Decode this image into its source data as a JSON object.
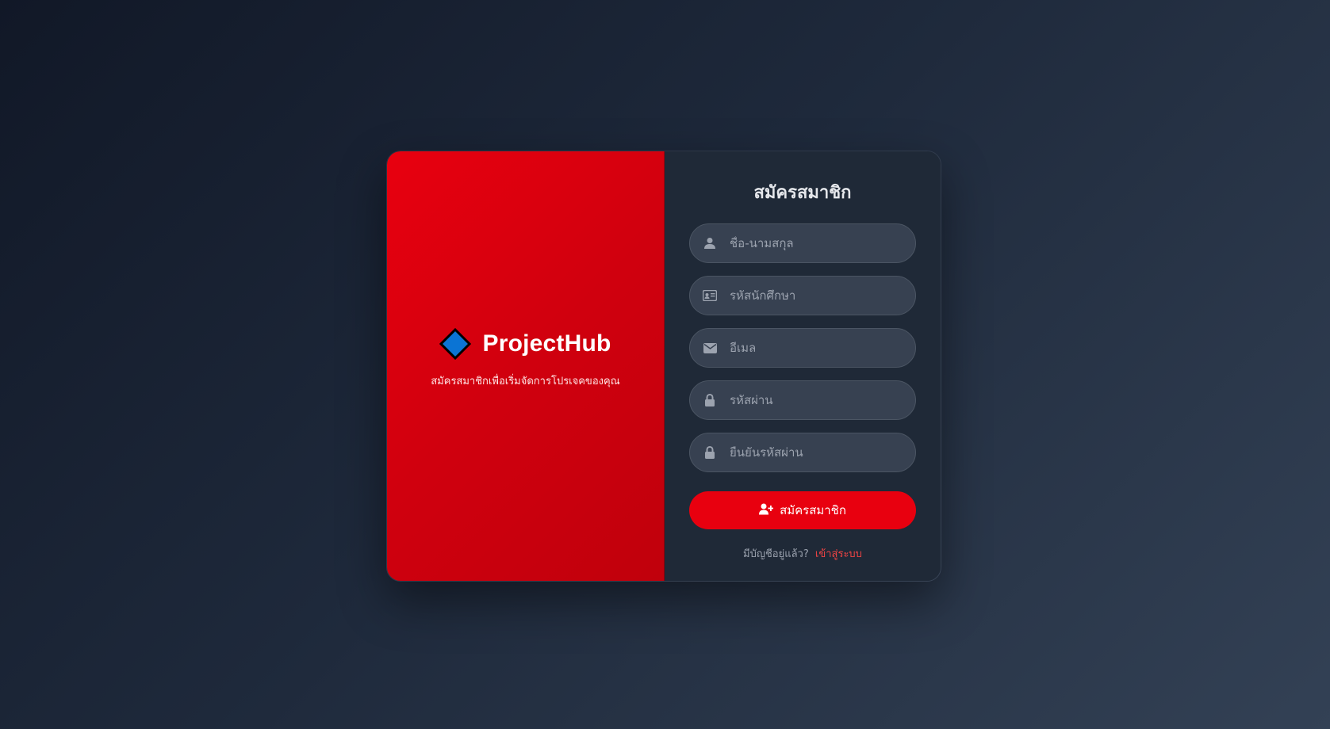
{
  "brand": {
    "title": "ProjectHub",
    "subtitle": "สมัครสมาชิกเพื่อเริ่มจัดการโปรเจคของคุณ",
    "icon": "diamond-icon"
  },
  "form": {
    "title": "สมัครสมาชิก",
    "fields": [
      {
        "placeholder": "ชื่อ-นามสกุล",
        "value": "",
        "icon": "user-icon"
      },
      {
        "placeholder": "รหัสนักศึกษา",
        "value": "",
        "icon": "id-card-icon"
      },
      {
        "placeholder": "อีเมล",
        "value": "",
        "icon": "envelope-icon"
      },
      {
        "placeholder": "รหัสผ่าน",
        "value": "",
        "icon": "lock-icon"
      },
      {
        "placeholder": "ยืนยันรหัสผ่าน",
        "value": "",
        "icon": "lock-icon"
      }
    ],
    "submit_label": "สมัครสมาชิก",
    "submit_icon": "user-plus-icon",
    "login_prompt": "มีบัญชีอยู่แล้ว?",
    "login_link": "เข้าสู่ระบบ"
  },
  "colors": {
    "accent": "#e8000f",
    "panel": "#1f2937",
    "input_bg": "#374151",
    "link": "#ef4444"
  }
}
